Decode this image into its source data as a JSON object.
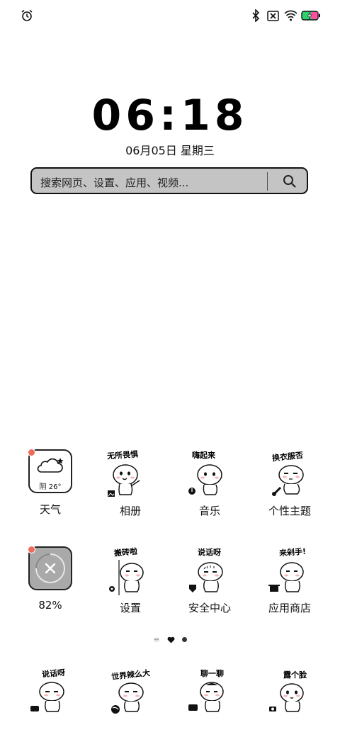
{
  "status_bar": {
    "left_icons": [
      "alarm-icon"
    ],
    "right_icons": [
      "bluetooth-icon",
      "no-sim-icon",
      "wifi-icon",
      "battery-charging-icon"
    ],
    "battery_color": "#22c55e"
  },
  "clock": {
    "time": "06:18",
    "date": "06月05日 星期三"
  },
  "search": {
    "placeholder": "搜索网页、设置、应用、视频..."
  },
  "apps_row1": [
    {
      "label": "天气",
      "temp": "阴 26°",
      "icon": "weather-icon"
    },
    {
      "label": "相册",
      "sticker": "无所畏惧",
      "icon": "gallery-icon"
    },
    {
      "label": "音乐",
      "sticker": "嗨起来",
      "icon": "music-icon"
    },
    {
      "label": "个性主题",
      "sticker": "换衣服否",
      "icon": "theme-icon"
    }
  ],
  "apps_row2": [
    {
      "label": "82%",
      "icon": "cleaner-icon"
    },
    {
      "label": "设置",
      "sticker": "搬砖啦",
      "icon": "settings-icon"
    },
    {
      "label": "安全中心",
      "sticker": "说话呀",
      "icon": "security-icon"
    },
    {
      "label": "应用商店",
      "sticker": "来剁手!",
      "icon": "store-icon"
    }
  ],
  "page_indicator": {
    "pages": 3,
    "current": 2
  },
  "dock": [
    {
      "sticker": "说话呀",
      "icon": "phone-icon"
    },
    {
      "sticker": "世界辣么大",
      "icon": "browser-icon"
    },
    {
      "sticker": "聊一聊",
      "icon": "messages-icon"
    },
    {
      "sticker": "露个脸",
      "icon": "camera-icon"
    }
  ]
}
